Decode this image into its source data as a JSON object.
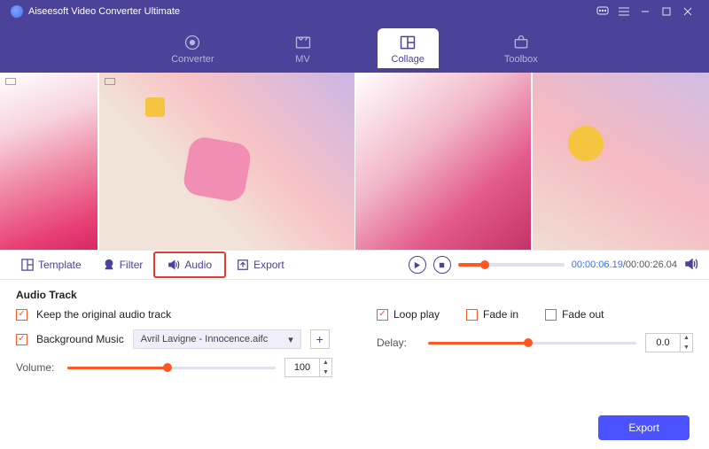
{
  "titlebar": {
    "title": "Aiseesoft Video Converter Ultimate"
  },
  "nav": {
    "converter": "Converter",
    "mv": "MV",
    "collage": "Collage",
    "toolbox": "Toolbox"
  },
  "tabs": {
    "template": "Template",
    "filter": "Filter",
    "audio": "Audio",
    "export": "Export"
  },
  "playback": {
    "current": "00:00:06.19",
    "total": "/00:00:26.04"
  },
  "panel": {
    "heading": "Audio Track",
    "keep_original": "Keep the original audio track",
    "bg_music_label": "Background Music",
    "bg_music_value": "Avril Lavigne - Innocence.aifc",
    "volume_label": "Volume:",
    "volume_value": "100",
    "loop_play": "Loop play",
    "fade_in": "Fade in",
    "fade_out": "Fade out",
    "delay_label": "Delay:",
    "delay_value": "0.0"
  },
  "footer": {
    "export": "Export"
  },
  "sliders": {
    "playback_pct": 25,
    "volume_pct": 48,
    "delay_pct": 48
  }
}
